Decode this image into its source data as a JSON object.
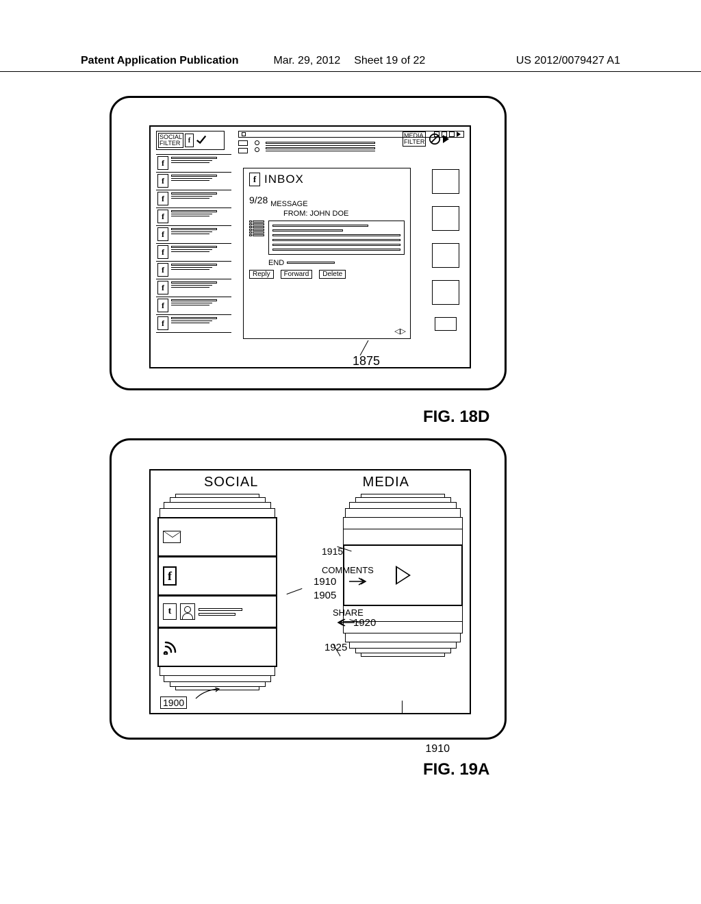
{
  "header": {
    "publication": "Patent Application Publication",
    "date": "Mar. 29, 2012",
    "sheet": "Sheet 19 of 22",
    "docnum": "US 2012/0079427 A1"
  },
  "fig18d": {
    "label": "FIG. 18D",
    "social_filter": "SOCIAL\nFILTER",
    "media_filter": "MEDIA\nFILTER",
    "inbox_title": "INBOX",
    "date": "9/28",
    "message": "MESSAGE",
    "from_line": "FROM: JOHN DOE",
    "end": "END",
    "reply": "Reply",
    "forward": "Forward",
    "delete": "Delete",
    "ref": "1875"
  },
  "fig19a": {
    "label": "FIG. 19A",
    "social": "SOCIAL",
    "media": "MEDIA",
    "comments": "COMMENTS",
    "share": "SHARE",
    "refs": {
      "r1900": "1900",
      "r1905": "1905",
      "r1910": "1910",
      "r1915": "1915",
      "r1920": "1920",
      "r1925": "1925"
    }
  }
}
